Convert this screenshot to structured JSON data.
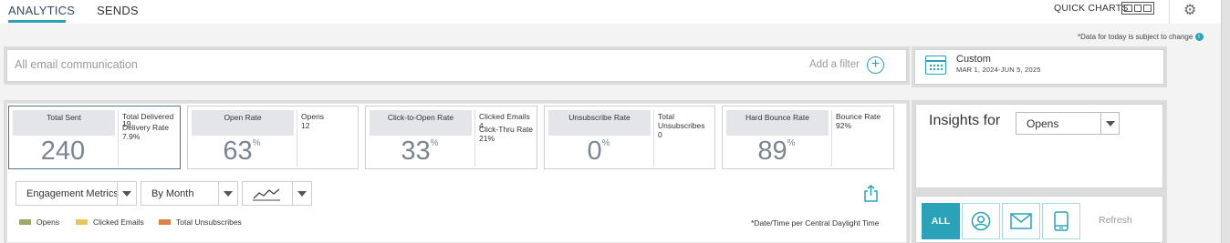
{
  "tabs": [
    {
      "label": "ANALYTICS",
      "active": true
    },
    {
      "label": "SENDS",
      "active": false
    }
  ],
  "quick_charts_label": "QUICK CHARTS",
  "data_note": "*Data for today is subject to change",
  "filter": {
    "placeholder": "All email communication",
    "add_label": "Add a filter"
  },
  "date": {
    "title": "Custom",
    "range": "MAR 1, 2024-JUN 5, 2025"
  },
  "metrics": [
    {
      "title": "Total Sent",
      "value": "240",
      "suffix": "",
      "side": [
        "Total Delivered",
        "19",
        "Delivery Rate",
        "7.9%"
      ]
    },
    {
      "title": "Open Rate",
      "value": "63",
      "suffix": "%",
      "side": [
        "Opens",
        "12"
      ]
    },
    {
      "title": "Click-to-Open Rate",
      "value": "33",
      "suffix": "%",
      "side": [
        "Clicked Emails",
        "4",
        "Click-Thru Rate",
        "21%"
      ]
    },
    {
      "title": "Unsubscribe Rate",
      "value": "0",
      "suffix": "%",
      "side": [
        "Total Unsubscribes",
        "0"
      ]
    },
    {
      "title": "Hard Bounce Rate",
      "value": "89",
      "suffix": "%",
      "side": [
        "Bounce Rate",
        "92%"
      ]
    }
  ],
  "controls": {
    "metric_select": "Engagement Metrics",
    "period_select": "By Month"
  },
  "legend": [
    {
      "label": "Opens",
      "color": "#9bab63"
    },
    {
      "label": "Clicked Emails",
      "color": "#e9c45c"
    },
    {
      "label": "Total Unsubscribes",
      "color": "#d9834a"
    }
  ],
  "chart_note": "*Date/Time per Central Daylight Time",
  "insights": {
    "title": "Insights for",
    "select": "Opens",
    "all_label": "ALL",
    "refresh_label": "Refresh"
  },
  "colors": {
    "accent": "#2aa3b8"
  }
}
